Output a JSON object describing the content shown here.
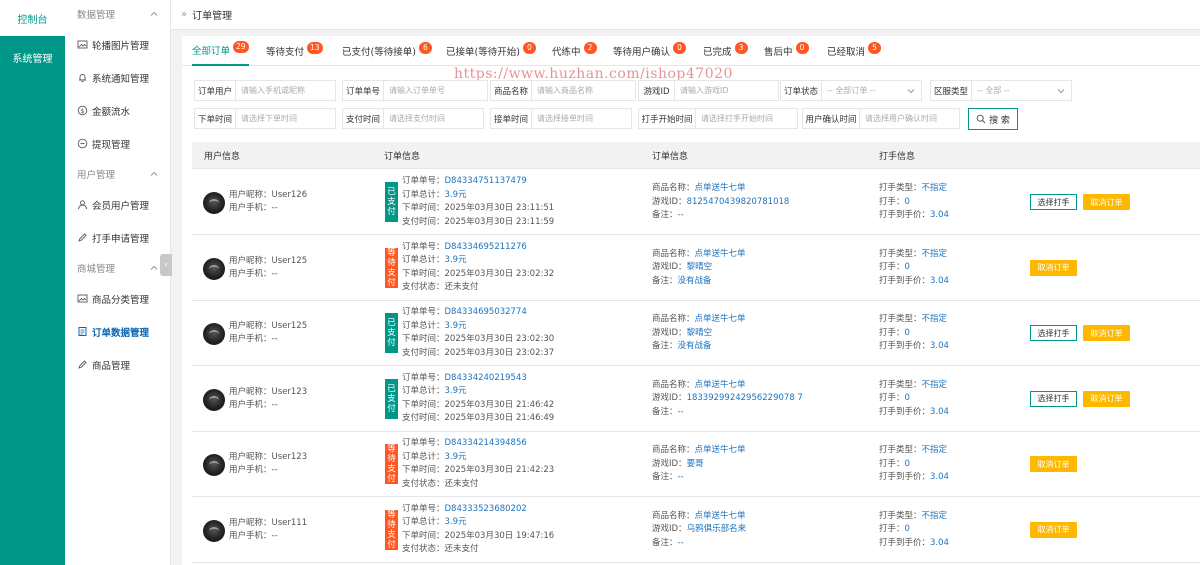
{
  "rail": {
    "top": "控制台",
    "active": "系统管理"
  },
  "menu": {
    "groups": [
      "数据管理",
      "用户管理",
      "商城管理"
    ],
    "items": [
      "轮播图片管理",
      "系统通知管理",
      "金额流水",
      "提现管理",
      "会员用户管理",
      "打手申请管理",
      "商品分类管理",
      "订单数据管理",
      "商品管理"
    ]
  },
  "header": {
    "breadcrumb": "订单管理"
  },
  "watermark": "https://www.huzhan.com/ishop47020",
  "tabs": [
    {
      "label": "全部订单",
      "count": "29"
    },
    {
      "label": "等待支付",
      "count": "13"
    },
    {
      "label": "已支付(等待接单)",
      "count": "6"
    },
    {
      "label": "已接单(等待开始)",
      "count": "0"
    },
    {
      "label": "代练中",
      "count": "2"
    },
    {
      "label": "等待用户确认",
      "count": "0"
    },
    {
      "label": "已完成",
      "count": "3"
    },
    {
      "label": "售后中",
      "count": "0"
    },
    {
      "label": "已经取消",
      "count": "5"
    }
  ],
  "filters": {
    "user_label": "订单用户",
    "user_ph": "请输入手机或昵称",
    "order_label": "订单单号",
    "order_ph": "请输入订单单号",
    "goods_label": "商品名称",
    "goods_ph": "请输入商品名称",
    "game_label": "游戏ID",
    "game_ph": "请输入游戏ID",
    "status_label": "订单状态",
    "status_value": "-- 全部订单 --",
    "region_label": "区服类型",
    "region_value": "-- 全部 --",
    "order_time_label": "下单时间",
    "order_time_ph": "请选择下单时间",
    "pay_time_label": "支付时间",
    "pay_time_ph": "请选择支付时间",
    "accept_time_label": "接单时间",
    "accept_time_ph": "请选择接单时间",
    "start_time_label": "打手开始时间",
    "start_time_ph": "请选择打手开始时间",
    "confirm_time_label": "用户确认时间",
    "confirm_time_ph": "请选择用户确认时间",
    "search_label": "搜 索"
  },
  "table": {
    "headers": [
      "用户信息",
      "订单信息",
      "订单信息",
      "打手信息"
    ],
    "labels": {
      "nickname": "用户昵称：",
      "phone": "用户手机：",
      "order_no": "订单单号：",
      "order_total": "订单总计：",
      "order_time": "下单时间：",
      "pay_time": "支付时间：",
      "pay_status": "支付状态：",
      "goods": "商品名称：",
      "game_id": "游戏ID：",
      "remark": "备注：",
      "player_type": "打手类型：",
      "player": "打手：",
      "player_price": "打手到手价："
    },
    "btn_select": "选择打手",
    "btn_cancel": "取消订单",
    "rows": [
      {
        "nickname": "User126",
        "phone": "--",
        "status": "已支付",
        "status_color": "green",
        "order_no": "D84334751137479",
        "total": "3.9元",
        "order_time": "2025年03月30日 23:11:51",
        "line4_label": "pay_time",
        "line4": "2025年03月30日 23:11:59",
        "goods": "点单送牛七单",
        "game_id": "8125470439820781018",
        "remark": "--",
        "player_type": "不指定",
        "player": "0",
        "player_price": "3.04",
        "can_select": true
      },
      {
        "nickname": "User125",
        "phone": "--",
        "status": "等待支付",
        "status_color": "orange",
        "order_no": "D84334695211276",
        "total": "3.9元",
        "order_time": "2025年03月30日 23:02:32",
        "line4_label": "pay_status",
        "line4": "还未支付",
        "goods": "点单送牛七单",
        "game_id": "黎晴空",
        "remark": "没有战备",
        "player_type": "不指定",
        "player": "0",
        "player_price": "3.04",
        "can_select": false
      },
      {
        "nickname": "User125",
        "phone": "--",
        "status": "已支付",
        "status_color": "green",
        "order_no": "D84334695032774",
        "total": "3.9元",
        "order_time": "2025年03月30日 23:02:30",
        "line4_label": "pay_time",
        "line4": "2025年03月30日 23:02:37",
        "goods": "点单送牛七单",
        "game_id": "黎晴空",
        "remark": "没有战备",
        "player_type": "不指定",
        "player": "0",
        "player_price": "3.04",
        "can_select": true
      },
      {
        "nickname": "User123",
        "phone": "--",
        "status": "已支付",
        "status_color": "green",
        "order_no": "D84334240219543",
        "total": "3.9元",
        "order_time": "2025年03月30日 21:46:42",
        "line4_label": "pay_time",
        "line4": "2025年03月30日 21:46:49",
        "goods": "点单送牛七单",
        "game_id": "18339299242956229078 7",
        "remark": "--",
        "player_type": "不指定",
        "player": "0",
        "player_price": "3.04",
        "can_select": true
      },
      {
        "nickname": "User123",
        "phone": "--",
        "status": "等待支付",
        "status_color": "orange",
        "order_no": "D84334214394856",
        "total": "3.9元",
        "order_time": "2025年03月30日 21:42:23",
        "line4_label": "pay_status",
        "line4": "还未支付",
        "goods": "点单送牛七单",
        "game_id": "要哥",
        "remark": "--",
        "player_type": "不指定",
        "player": "0",
        "player_price": "3.04",
        "can_select": false
      },
      {
        "nickname": "User111",
        "phone": "--",
        "status": "等待支付",
        "status_color": "orange",
        "order_no": "D84333523680202",
        "total": "3.9元",
        "order_time": "2025年03月30日 19:47:16",
        "line4_label": "pay_status",
        "line4": "还未支付",
        "goods": "点单送牛七单",
        "game_id": "乌鸦俱乐部名来",
        "remark": "--",
        "player_type": "不指定",
        "player": "0",
        "player_price": "3.04",
        "can_select": false
      }
    ]
  },
  "colors": {
    "primary": "#009688",
    "danger": "#ff5722",
    "warn": "#ffb800",
    "link": "#1e73be"
  }
}
